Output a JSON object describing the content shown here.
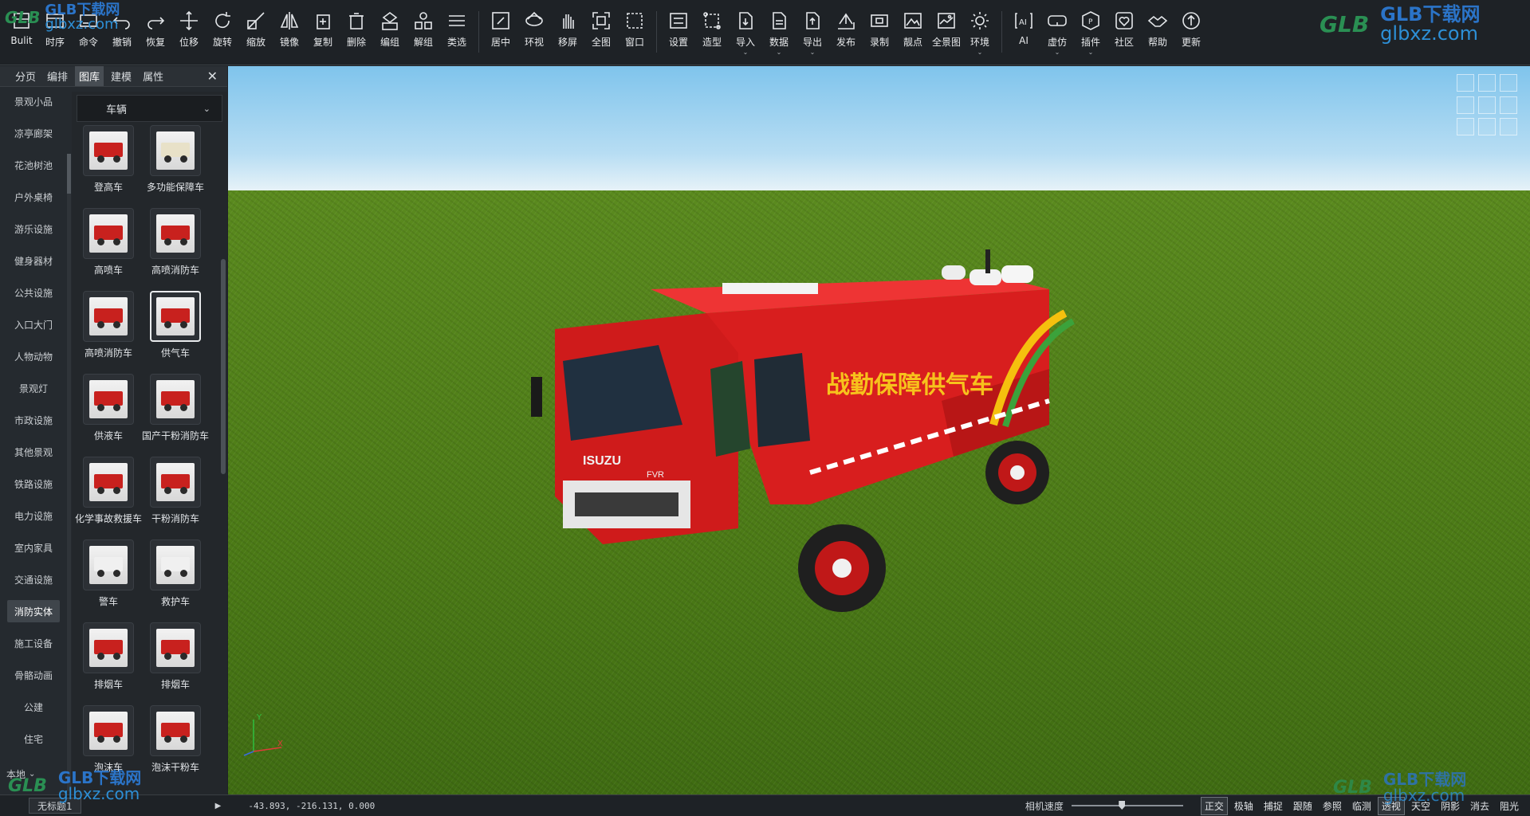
{
  "toolbar": {
    "groups": [
      [
        {
          "label": "Bulit",
          "icon": "grid-icon"
        },
        {
          "label": "时序",
          "icon": "timeline-icon"
        },
        {
          "label": "命令",
          "icon": "command-icon"
        },
        {
          "label": "撤销",
          "icon": "undo-icon"
        },
        {
          "label": "恢复",
          "icon": "redo-icon"
        },
        {
          "label": "位移",
          "icon": "move-icon"
        },
        {
          "label": "旋转",
          "icon": "rotate-icon"
        },
        {
          "label": "缩放",
          "icon": "scale-icon"
        },
        {
          "label": "镜像",
          "icon": "mirror-icon"
        },
        {
          "label": "复制",
          "icon": "copy-icon"
        },
        {
          "label": "删除",
          "icon": "trash-icon"
        },
        {
          "label": "编组",
          "icon": "group-icon"
        },
        {
          "label": "解组",
          "icon": "ungroup-icon"
        },
        {
          "label": "类选",
          "icon": "list-select-icon"
        }
      ],
      [
        {
          "label": "居中",
          "icon": "center-icon"
        },
        {
          "label": "环视",
          "icon": "orbit-icon"
        },
        {
          "label": "移屏",
          "icon": "hand-icon"
        },
        {
          "label": "全图",
          "icon": "fit-all-icon"
        },
        {
          "label": "窗口",
          "icon": "window-zoom-icon"
        }
      ],
      [
        {
          "label": "设置",
          "icon": "settings-icon"
        },
        {
          "label": "造型",
          "icon": "shape-icon"
        },
        {
          "label": "导入",
          "icon": "import-icon",
          "dropdown": true
        },
        {
          "label": "数据",
          "icon": "data-icon",
          "dropdown": true
        },
        {
          "label": "导出",
          "icon": "export-icon",
          "dropdown": true
        },
        {
          "label": "发布",
          "icon": "publish-icon"
        },
        {
          "label": "录制",
          "icon": "record-icon"
        },
        {
          "label": "靓点",
          "icon": "image-icon"
        },
        {
          "label": "全景图",
          "icon": "panorama-icon"
        },
        {
          "label": "环境",
          "icon": "sun-icon",
          "dropdown": true
        }
      ],
      [
        {
          "label": "AI",
          "icon": "ai-icon"
        },
        {
          "label": "虚仿",
          "icon": "vr-icon",
          "dropdown": true
        },
        {
          "label": "插件",
          "icon": "plugin-icon",
          "dropdown": true
        },
        {
          "label": "社区",
          "icon": "community-icon"
        },
        {
          "label": "帮助",
          "icon": "help-icon"
        },
        {
          "label": "更新",
          "icon": "update-icon"
        }
      ]
    ]
  },
  "panel": {
    "tabs": [
      "分页",
      "编排",
      "图库",
      "建模",
      "属性"
    ],
    "active_tab": 2,
    "close": "✕",
    "categories": [
      "景观小品",
      "凉亭廊架",
      "花池树池",
      "户外桌椅",
      "游乐设施",
      "健身器材",
      "公共设施",
      "入口大门",
      "人物动物",
      "景观灯",
      "市政设施",
      "其他景观",
      "铁路设施",
      "电力设施",
      "室内家具",
      "交通设施",
      "消防实体",
      "施工设备",
      "骨骼动画",
      "公建",
      "住宅"
    ],
    "active_category": 16,
    "local_label": "本地",
    "gallery_select": "车辆",
    "items": [
      {
        "label": "登高车"
      },
      {
        "label": "多功能保障车"
      },
      {
        "label": "高喷车"
      },
      {
        "label": "高喷消防车"
      },
      {
        "label": "高喷消防车"
      },
      {
        "label": "供气车",
        "selected": true
      },
      {
        "label": "供液车"
      },
      {
        "label": "国产干粉消防车"
      },
      {
        "label": "化学事故救援车"
      },
      {
        "label": "干粉消防车"
      },
      {
        "label": "警车"
      },
      {
        "label": "救护车"
      },
      {
        "label": "排烟车"
      },
      {
        "label": "排烟车"
      },
      {
        "label": "泡沫车"
      },
      {
        "label": "泡沫干粉车"
      }
    ]
  },
  "viewport": {
    "truck_text": "战勤保障供气车",
    "brand": "ISUZU",
    "model": "FVR",
    "axis_labels": {
      "y": "Y",
      "x": "X"
    }
  },
  "status": {
    "file_tab": "无标题1",
    "coords": "-43.893, -216.131, 0.000",
    "speed_label": "相机速度",
    "speed_value": 0.45,
    "modes": [
      {
        "label": "正交",
        "on": true
      },
      {
        "label": "极轴",
        "on": false
      },
      {
        "label": "捕捉",
        "on": false
      },
      {
        "label": "跟随",
        "on": false
      },
      {
        "label": "参照",
        "on": false
      },
      {
        "label": "临测",
        "on": false
      },
      {
        "label": "透视",
        "on": true
      },
      {
        "label": "天空",
        "on": false
      },
      {
        "label": "阴影",
        "on": false
      },
      {
        "label": "消去",
        "on": false
      },
      {
        "label": "阻光",
        "on": false
      }
    ]
  },
  "watermark": {
    "logo": "GLB",
    "top": "GLB下载网",
    "bottom": "glbxz.com"
  }
}
